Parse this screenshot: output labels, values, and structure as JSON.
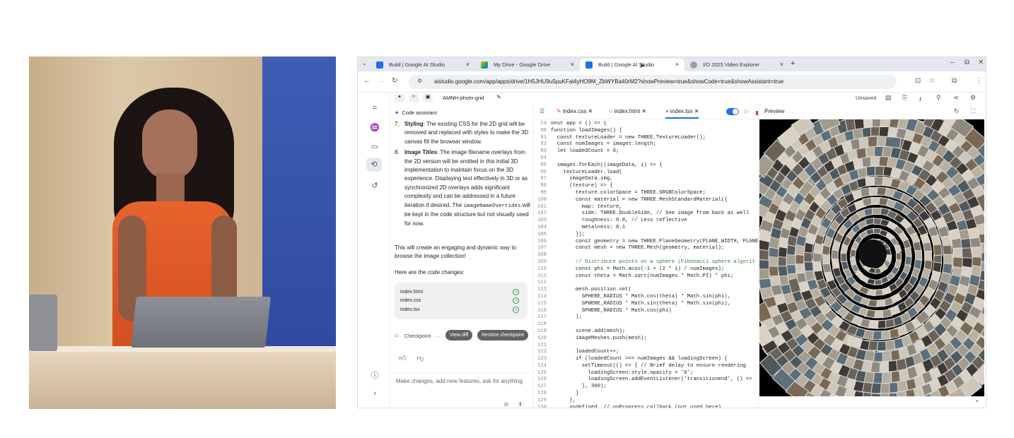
{
  "browser": {
    "tabs": [
      {
        "label": "Build | Google AI Studio",
        "close": "×"
      },
      {
        "label": "My Drive - Google Drive",
        "close": "×"
      },
      {
        "label": "Build | Google AI Studio",
        "close": "×"
      },
      {
        "label": "I/O 2025 Video Explorer",
        "close": "×"
      }
    ],
    "new_tab": "+",
    "url": "aistudio.google.com/app/apps/drive/1H5JHU9u5puKFal4yHO9M_ZbWYBa40rM2?showPreview=true&showCode=true&showAssistant=true",
    "window_controls": [
      "–",
      "⧉",
      "✕"
    ]
  },
  "project": {
    "name": "AMNH-photo-grid",
    "status": "Unsaved"
  },
  "assistant": {
    "header": "Code assistant",
    "items": [
      {
        "num": "7.",
        "title": "Styling",
        "text": ": The existing CSS for the 2D grid will be removed and replaced with styles to make the 3D canvas fill the browser window."
      },
      {
        "num": "8.",
        "title": "Image Titles",
        "text": ": The image filename overlays from the 2D version will be omitted in this initial 3D implementation to maintain focus on the 3D experience. Displaying text effectively in 3D or as synchronized 2D overlays adds significant complexity and can be addressed in a future iteration if desired. The ",
        "code": "imageNameOverrides",
        "text2": " will be kept in the code structure but not visually used for now."
      }
    ],
    "summary": "This will create an engaging and dynamic way to browse the image collection!",
    "changes_label": "Here are the code changes:",
    "files": [
      "index.html",
      "index.css",
      "index.tsx"
    ],
    "checkpoint_label": "Checkpoint",
    "view_diff": "View diff",
    "restore": "Restore checkpoint",
    "input_placeholder": "Make changes, add new features, ask for anything"
  },
  "editor": {
    "tabs": [
      "index.css",
      "index.html",
      "index.tsx"
    ],
    "active_tab": "index.tsx",
    "lines": [
      {
        "n": "24",
        "t": "onst app = () => {"
      },
      {
        "n": "90",
        "t": "function loadImages() {"
      },
      {
        "n": "91",
        "t": "  const textureLoader = new THREE.TextureLoader();"
      },
      {
        "n": "92",
        "t": "  const numImages = images.length;"
      },
      {
        "n": "93",
        "t": "  let loadedCount = 0;"
      },
      {
        "n": "94",
        "t": ""
      },
      {
        "n": "95",
        "t": "  images.forEach((imageData, i) => {"
      },
      {
        "n": "96",
        "t": "    textureLoader.load("
      },
      {
        "n": "97",
        "t": "      imageData.img,"
      },
      {
        "n": "98",
        "t": "      (texture) => {"
      },
      {
        "n": "99",
        "t": "        texture.colorSpace = THREE.SRGBColorSpace;"
      },
      {
        "n": "100",
        "t": "        const material = new THREE.MeshStandardMaterial({"
      },
      {
        "n": "101",
        "t": "          map: texture,"
      },
      {
        "n": "102",
        "t": "          side: THREE.DoubleSide, // See image from back as well"
      },
      {
        "n": "103",
        "t": "          roughness: 0.8, // Less reflective"
      },
      {
        "n": "104",
        "t": "          metalness: 0.1"
      },
      {
        "n": "105",
        "t": "        });"
      },
      {
        "n": "106",
        "t": "        const geometry = new THREE.PlaneGeometry(PLANE_WIDTH, PLANE"
      },
      {
        "n": "107",
        "t": "        const mesh = new THREE.Mesh(geometry, material);"
      },
      {
        "n": "108",
        "t": ""
      },
      {
        "n": "109",
        "t": "        // Distribute points on a sphere (Fibonacci sphere algorit"
      },
      {
        "n": "110",
        "t": "        const phi = Math.acos(-1 + (2 * i) / numImages);"
      },
      {
        "n": "111",
        "t": "        const theta = Math.sqrt(numImages * Math.PI) * phi;"
      },
      {
        "n": "112",
        "t": ""
      },
      {
        "n": "113",
        "t": "        mesh.position.set("
      },
      {
        "n": "114",
        "t": "          SPHERE_RADIUS * Math.cos(theta) * Math.sin(phi),"
      },
      {
        "n": "115",
        "t": "          SPHERE_RADIUS * Math.sin(theta) * Math.sin(phi),"
      },
      {
        "n": "116",
        "t": "          SPHERE_RADIUS * Math.cos(phi)"
      },
      {
        "n": "117",
        "t": "        );"
      },
      {
        "n": "118",
        "t": ""
      },
      {
        "n": "119",
        "t": "        scene.add(mesh);"
      },
      {
        "n": "120",
        "t": "        imageMeshes.push(mesh);"
      },
      {
        "n": "121",
        "t": ""
      },
      {
        "n": "122",
        "t": "        loadedCount++;"
      },
      {
        "n": "123",
        "t": "        if (loadedCount === numImages && loadingScreen) {"
      },
      {
        "n": "124",
        "t": "          setTimeout(() => { // Brief delay to ensure rendering"
      },
      {
        "n": "125",
        "t": "            loadingScreen.style.opacity = '0';"
      },
      {
        "n": "126",
        "t": "            loadingScreen.addEventListener('transitionend', () =>"
      },
      {
        "n": "127",
        "t": "          }, 300);"
      },
      {
        "n": "128",
        "t": "        }"
      },
      {
        "n": "129",
        "t": "      },"
      },
      {
        "n": "130",
        "t": "      undefined, // onProgress callback (not used here)"
      }
    ]
  },
  "preview": {
    "label": "Preview"
  },
  "colors": {
    "accent": "#1a73e8",
    "dress": "#e8622d"
  }
}
